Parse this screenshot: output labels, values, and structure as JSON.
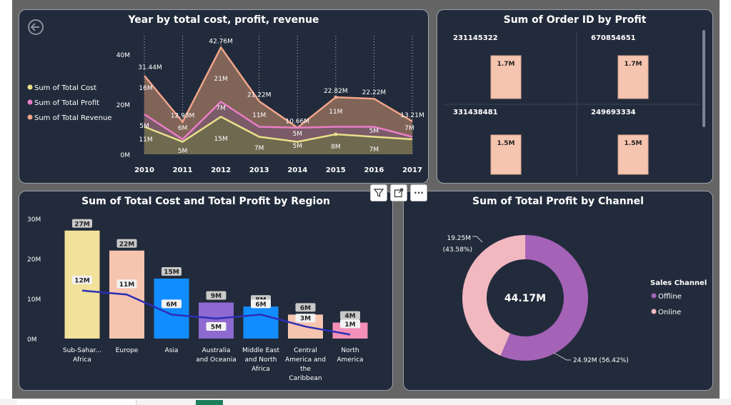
{
  "colors": {
    "panel_bg": "#222b3b",
    "cost": "#e8e08a",
    "profit": "#e97ec6",
    "revenue": "#f0a58a",
    "bar_yellow": "#f1e19a",
    "bar_peach": "#f6c5b0",
    "bar_blue": "#118dff",
    "bar_purple": "#8e6ad0",
    "bar_pink": "#f48fb8",
    "profit_line": "#2b2fb5",
    "offline": "#a463b7",
    "online": "#f2b8c0"
  },
  "toolbar": {
    "filter_icon": "filter-icon",
    "focus_icon": "focus-mode-icon",
    "more_icon": "more-options-icon",
    "more_label": "···"
  },
  "line_chart": {
    "back_icon": "back-arrow-icon",
    "chart_data": {
      "type": "area",
      "title": "Year by total cost, profit, revenue",
      "x": [
        "2010",
        "2011",
        "2012",
        "2013",
        "2014",
        "2015",
        "2016",
        "2017"
      ],
      "y_ticks": [
        "0M",
        "20M",
        "40M"
      ],
      "ylim": [
        0,
        44
      ],
      "legend_position": "left",
      "series": [
        {
          "name": "Sum of Total Cost",
          "values": [
            11,
            5,
            15,
            7,
            5,
            8,
            7,
            6
          ],
          "labels": [
            "11M",
            "5M",
            "15M",
            "7M",
            "5M",
            "8M",
            "7M",
            ""
          ]
        },
        {
          "name": "Sum of Total Profit",
          "values": [
            16,
            6,
            21,
            11,
            10.66,
            11,
            11,
            7
          ],
          "labels": [
            "5M",
            "6M",
            "7M",
            "11M",
            "5M",
            "11M",
            "5M",
            "7M"
          ]
        },
        {
          "name": "Sum of Total Revenue",
          "values": [
            31.44,
            12.93,
            42.76,
            21.22,
            10.66,
            22.82,
            22.22,
            13.21
          ],
          "labels": [
            "31.44M",
            "12.93M",
            "42.76M",
            "21.22M",
            "10.66M",
            "22.82M",
            "22.22M",
            "13.21M"
          ]
        }
      ],
      "extra_labels": [
        "16M",
        "21M"
      ]
    }
  },
  "cards": {
    "chart_data": {
      "type": "bar",
      "title": "Sum of Order ID by Profit",
      "items": [
        {
          "header": "231145322",
          "label": "1.7M",
          "value": 1.7
        },
        {
          "header": "670854651",
          "label": "1.7M",
          "value": 1.7
        },
        {
          "header": "331438481",
          "label": "1.5M",
          "value": 1.5
        },
        {
          "header": "249693334",
          "label": "1.5M",
          "value": 1.5
        }
      ]
    }
  },
  "region_chart": {
    "chart_data": {
      "type": "bar",
      "title": "Sum of Total Cost and Total Profit by Region",
      "categories": [
        [
          "Sub-Sahar...",
          "Africa"
        ],
        [
          "Europe"
        ],
        [
          "Asia"
        ],
        [
          "Australia",
          "and Oceania"
        ],
        [
          "Middle East",
          "and North",
          "Africa"
        ],
        [
          "Central",
          "America and",
          "the",
          "Caribbean"
        ],
        [
          "North",
          "America"
        ]
      ],
      "y_ticks": [
        "0M",
        "10M",
        "20M",
        "30M"
      ],
      "ylim": [
        0,
        30
      ],
      "cost": {
        "values": [
          27,
          22,
          15,
          9,
          8,
          6,
          4
        ],
        "labels": [
          "27M",
          "22M",
          "15M",
          "9M",
          "8M",
          "6M",
          "4M"
        ]
      },
      "profit": {
        "values": [
          12,
          11,
          6,
          5,
          6,
          3,
          1
        ],
        "labels": [
          "12M",
          "11M",
          "6M",
          "5M",
          "6M",
          "3M",
          "1M"
        ]
      }
    }
  },
  "donut": {
    "chart_data": {
      "type": "pie",
      "title": "Sum of Total Profit by Channel",
      "center_label": "44.17M",
      "legend_title": "Sales Channel",
      "slices": [
        {
          "name": "Offline",
          "value": 24.92,
          "label": "24.92M (56.42%)"
        },
        {
          "name": "Online",
          "value": 19.25,
          "label_line1": "19.25M",
          "label_line2": "(43.58%)"
        }
      ]
    }
  }
}
